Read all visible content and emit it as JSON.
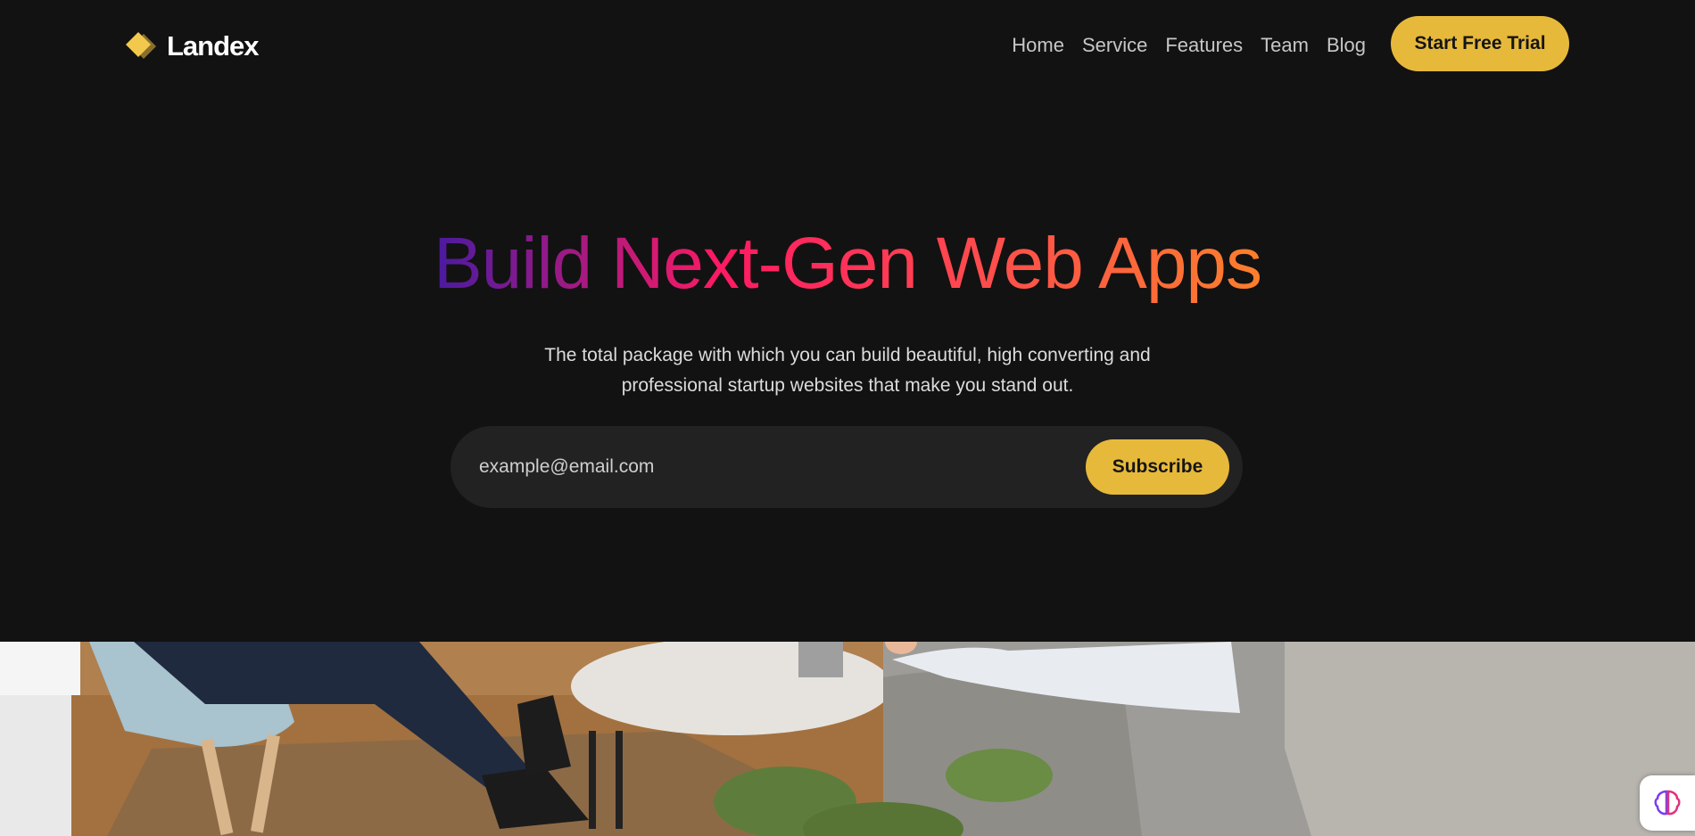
{
  "brand": {
    "name": "Landex",
    "icon": "diamond-logo-icon",
    "accent": "#e7b93b"
  },
  "nav": {
    "items": [
      {
        "label": "Home"
      },
      {
        "label": "Service"
      },
      {
        "label": "Features"
      },
      {
        "label": "Team"
      },
      {
        "label": "Blog"
      }
    ],
    "cta_label": "Start Free Trial"
  },
  "hero": {
    "title": "Build Next-Gen Web Apps",
    "subtitle_line1": "The total package with which you can build beautiful, high converting and",
    "subtitle_line2": "professional startup websites that make you stand out.",
    "gradient": [
      "#4a1aa0",
      "#ff1a63",
      "#ff4a4e",
      "#fb7f2c"
    ]
  },
  "subscribe": {
    "placeholder": "example@email.com",
    "button_label": "Subscribe"
  },
  "widget": {
    "icon": "brain-icon"
  },
  "colors": {
    "background": "#121212",
    "input_bg": "#222222"
  }
}
